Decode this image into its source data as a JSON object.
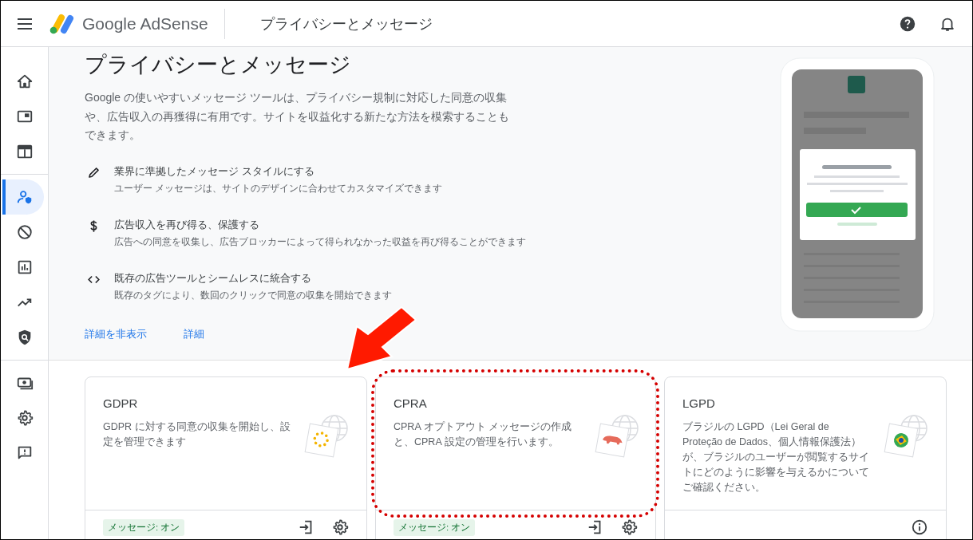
{
  "header": {
    "product": "Google AdSense",
    "page_title": "プライバシーとメッセージ"
  },
  "sidebar": {
    "items": [
      {
        "selected": false
      },
      {
        "selected": false
      },
      {
        "selected": false
      },
      {
        "selected": true
      },
      {
        "selected": false
      },
      {
        "selected": false
      },
      {
        "selected": false
      },
      {
        "selected": false
      },
      {
        "selected": false
      },
      {
        "selected": false
      },
      {
        "selected": false
      }
    ]
  },
  "hero": {
    "title": "プライバシーとメッセージ",
    "description": "Google の使いやすいメッセージ ツールは、プライバシー規制に対応した同意の収集や、広告収入の再獲得に有用です。サイトを収益化する新たな方法を模索することもできます。",
    "features": [
      {
        "title": "業界に準拠したメッセージ スタイルにする",
        "subtitle": "ユーザー メッセージは、サイトのデザインに合わせてカスタマイズできます"
      },
      {
        "title": "広告収入を再び得る、保護する",
        "subtitle": "広告への同意を収集し、広告ブロッカーによって得られなかった収益を再び得ることができます"
      },
      {
        "title": "既存の広告ツールとシームレスに統合する",
        "subtitle": "既存のタグにより、数回のクリックで同意の収集を開始できます"
      }
    ],
    "links": [
      "詳細を非表示",
      "詳細"
    ]
  },
  "cards": [
    {
      "title": "GDPR",
      "description": "GDPR に対する同意の収集を開始し、設定を管理できます",
      "kind": "managed",
      "status": "メッセージ: オン",
      "highlighted": false
    },
    {
      "title": "CPRA",
      "description": "CPRA オプトアウト メッセージの作成と、CPRA 設定の管理を行います。",
      "kind": "managed",
      "status": "メッセージ: オン",
      "highlighted": true
    },
    {
      "title": "LGPD",
      "description": "ブラジルの LGPD（Lei Geral de Proteção de Dados、個人情報保護法）が、ブラジルのユーザーが閲覧するサイトにどのように影響を与えるかについてご確認ください。",
      "kind": "info",
      "highlighted": false
    }
  ]
}
